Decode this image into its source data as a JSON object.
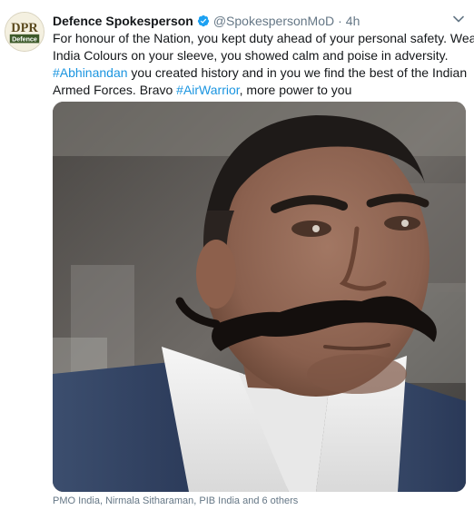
{
  "tweet": {
    "avatar": {
      "logo_text_top": "DPR",
      "logo_text_bottom": "Defence"
    },
    "author": {
      "display_name": "Defence Spokesperson",
      "handle": "@SpokespersonMoD",
      "separator": "·",
      "time": "4h",
      "verified_icon": "verified-badge-icon"
    },
    "text_lines": [
      {
        "plain": "For honour of the Nation, you kept duty ahead of your personal safety. Wearing"
      },
      {
        "plain": "India Colours on your sleeve, you showed calm and poise in adversity."
      },
      {
        "tag": "#Abhinandan",
        "plain": " you created history and in you we find  the best of the Indian"
      },
      {
        "plain": "Armed Forces. Bravo ",
        "tag": "#AirWarrior",
        "after": ", more power to you"
      }
    ],
    "liked_by": "PMO India, Nirmala Sitharaman, PIB India and 6 others"
  },
  "colors": {
    "link": "#1b95e0",
    "secondary_text": "#657786",
    "verified": "#1da1f2"
  }
}
